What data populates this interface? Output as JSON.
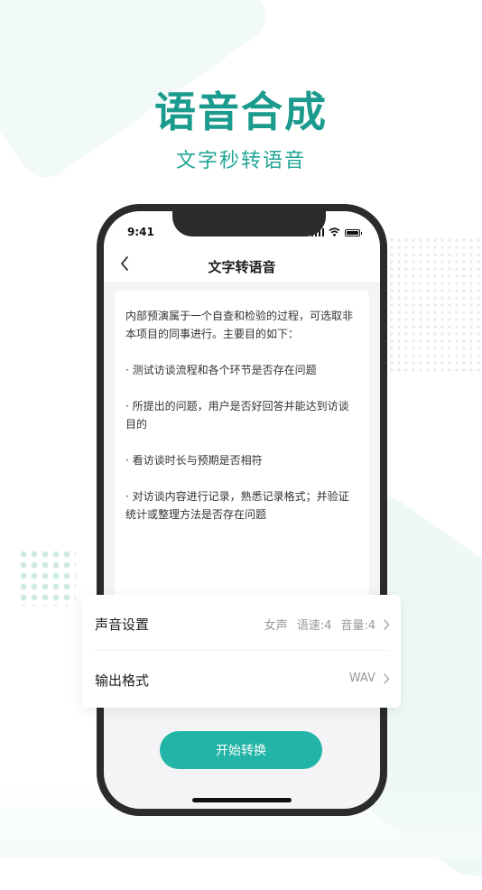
{
  "hero": {
    "title": "语音合成",
    "subtitle": "文字秒转语音"
  },
  "status_bar": {
    "time": "9:41"
  },
  "nav": {
    "title": "文字转语音"
  },
  "text_card": {
    "content": "内部预演属于一个自查和检验的过程，可选取非本项目的同事进行。主要目的如下：\n\n· 测试访谈流程和各个环节是否存在问题\n\n· 所提出的问题，用户是否好回答并能达到访谈目的\n\n· 看访谈时长与预期是否相符\n\n· 对访谈内容进行记录，熟悉记录格式；并验证统计或整理方法是否存在问题"
  },
  "settings": {
    "voice": {
      "label": "声音设置",
      "gender": "女声",
      "speed": "语速:4",
      "volume": "音量:4"
    },
    "format": {
      "label": "输出格式",
      "value": "WAV"
    }
  },
  "actions": {
    "start_label": "开始转换"
  },
  "colors": {
    "accent": "#22b4a6",
    "title": "#1a9b8d"
  }
}
